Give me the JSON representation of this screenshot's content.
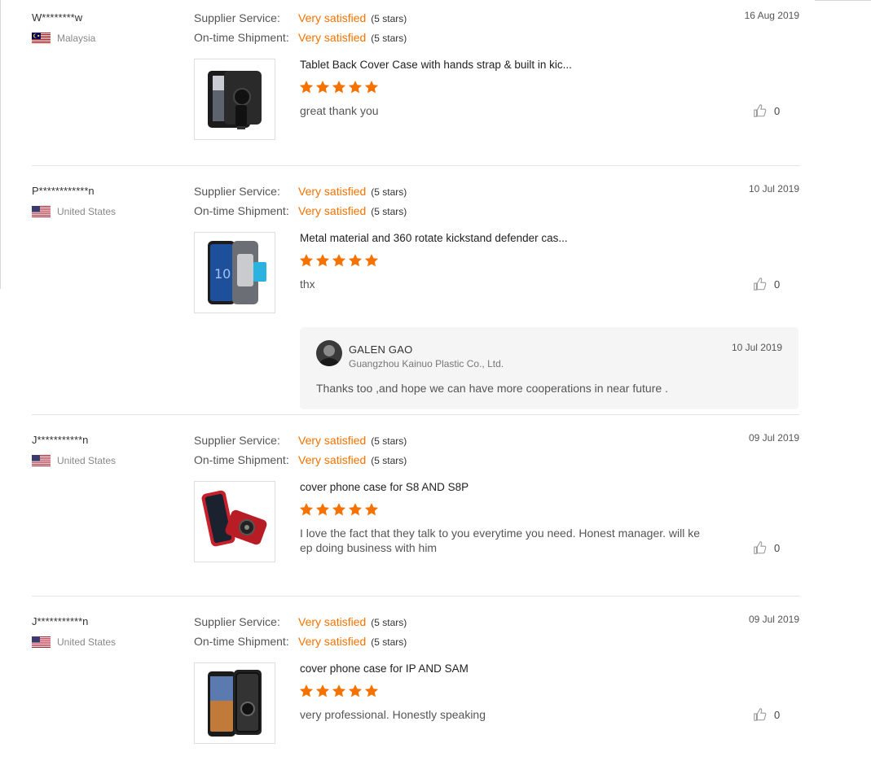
{
  "labels": {
    "supplier_service": "Supplier Service:",
    "ontime_shipment": "On-time Shipment:"
  },
  "accent_color": "#f57200",
  "reviews": [
    {
      "buyer": "W********w",
      "country": "Malaysia",
      "flag": "malaysia-flag",
      "date": "16 Aug 2019",
      "supplier_service": "Very satisfied",
      "supplier_service_count": "(5 stars)",
      "ontime_shipment": "Very satisfied",
      "ontime_shipment_count": "(5 stars)",
      "product": "Tablet Back Cover Case with hands strap & built in kic...",
      "stars": 5,
      "comment": "great thank you",
      "likes": "0"
    },
    {
      "buyer": "P************n",
      "country": "United States",
      "flag": "us-flag",
      "date": "10 Jul 2019",
      "supplier_service": "Very satisfied",
      "supplier_service_count": "(5 stars)",
      "ontime_shipment": "Very satisfied",
      "ontime_shipment_count": "(5 stars)",
      "product": "Metal material and 360 rotate kickstand defender cas...",
      "stars": 5,
      "comment": "thx",
      "likes": "0",
      "reply": {
        "name": "GALEN GAO",
        "company": "Guangzhou Kainuo Plastic Co., Ltd.",
        "date": "10 Jul 2019",
        "text": "Thanks too ,and hope we can have more cooperations in near future ."
      }
    },
    {
      "buyer": "J***********n",
      "country": "United States",
      "flag": "us-flag",
      "date": "09 Jul 2019",
      "supplier_service": "Very satisfied",
      "supplier_service_count": "(5 stars)",
      "ontime_shipment": "Very satisfied",
      "ontime_shipment_count": "(5 stars)",
      "product": "cover phone case for S8 AND S8P",
      "stars": 5,
      "comment": "I love the fact that they talk to you everytime you need. Honest manager. will keep doing business with him",
      "likes": "0"
    },
    {
      "buyer": "J***********n",
      "country": "United States",
      "flag": "us-flag",
      "date": "09 Jul 2019",
      "supplier_service": "Very satisfied",
      "supplier_service_count": "(5 stars)",
      "ontime_shipment": "Very satisfied",
      "ontime_shipment_count": "(5 stars)",
      "product": "cover phone case for IP AND SAM",
      "stars": 5,
      "comment": "very professional. Honestly speaking",
      "likes": "0"
    }
  ]
}
